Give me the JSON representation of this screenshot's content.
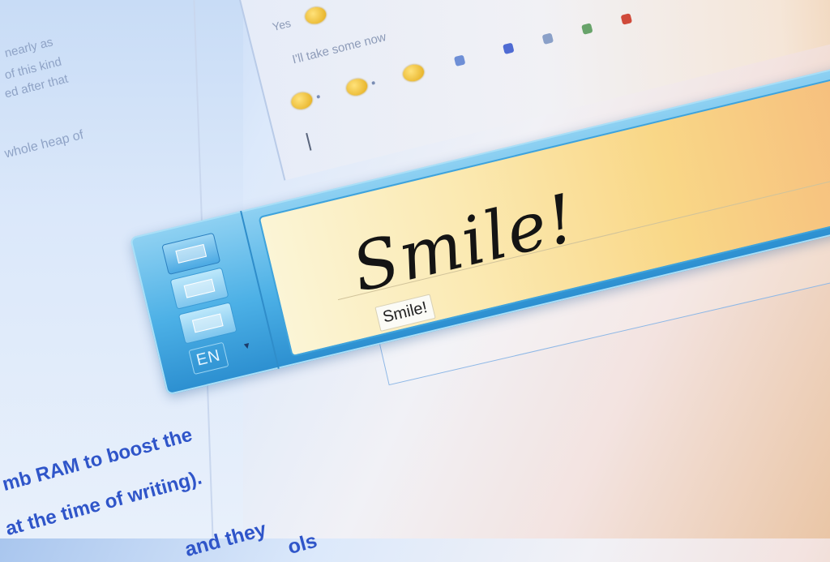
{
  "article": {
    "faint_lines": [
      "nearly as",
      "of this kind",
      "ed after that",
      "whole heap of"
    ],
    "bold_lines": [
      "mb RAM to boost the",
      "at the time of writing).",
      "and they",
      "ols"
    ]
  },
  "chat": {
    "lines": [
      "Yes",
      "I'll take some now"
    ],
    "colors": {
      "emoticon": "#f2c230",
      "toolbar_icons": [
        "#6e8fd6",
        "#4f6bd3",
        "#8aa0c8",
        "#68a36a",
        "#d04a3a"
      ]
    }
  },
  "tip": {
    "mode_buttons": [
      {
        "name": "writing-pad-mode",
        "active": true
      },
      {
        "name": "character-pad-mode",
        "active": false
      },
      {
        "name": "keyboard-mode",
        "active": false
      }
    ],
    "language": "EN",
    "handwriting": "Smile!",
    "suggestion": "Smile!",
    "colors": {
      "frame": "#4cb0e6",
      "pad_start": "#fbf5d6",
      "pad_end": "#f5b57a"
    }
  }
}
